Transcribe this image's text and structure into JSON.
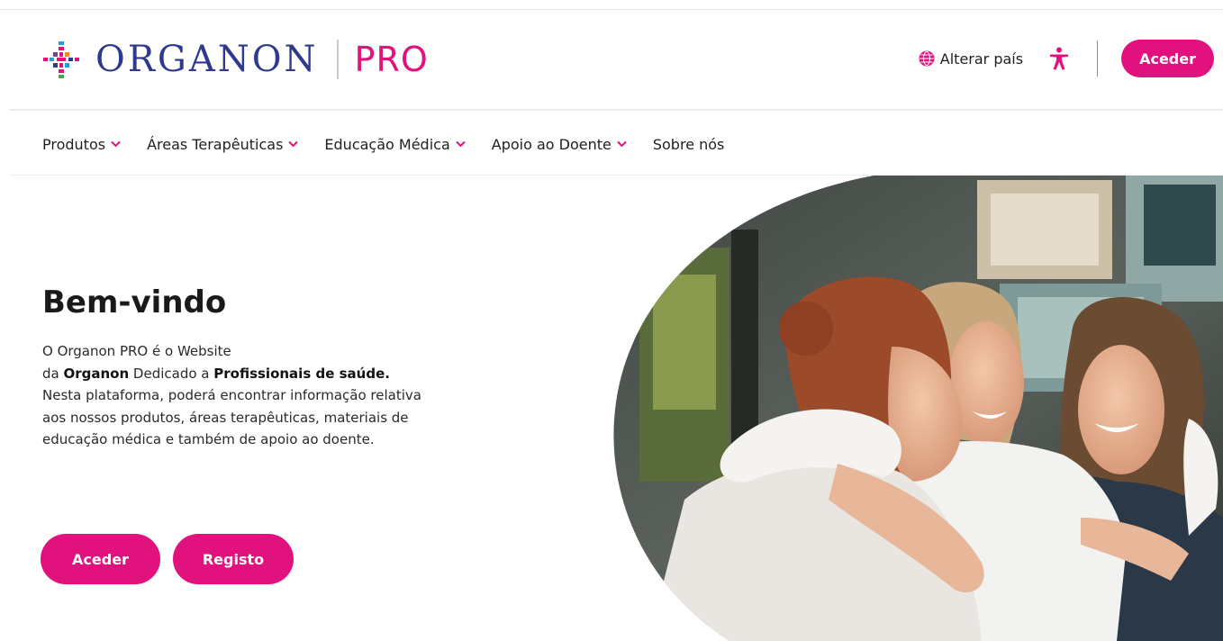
{
  "header": {
    "logo_word": "ORGANON",
    "logo_suffix": "PRO",
    "change_country": "Alterar país",
    "login_button": "Aceder"
  },
  "nav": {
    "items": [
      {
        "label": "Produtos",
        "dropdown": true
      },
      {
        "label": "Áreas Terapêuticas",
        "dropdown": true
      },
      {
        "label": "Educação Médica",
        "dropdown": true
      },
      {
        "label": "Apoio ao Doente",
        "dropdown": true
      },
      {
        "label": "Sobre nós",
        "dropdown": false
      }
    ]
  },
  "hero": {
    "title": "Bem-vindo",
    "text": {
      "p1": "O Organon PRO é o Website",
      "p2": "da ",
      "b1": "Organon",
      "p3": " Dedicado a ",
      "b2": "Profissionais de saúde.",
      "p4": " Nesta plataforma, poderá encontrar informação relativa aos nossos produtos, áreas terapêuticas, materiais de educação médica e também de apoio ao doente."
    },
    "buttons": {
      "login": "Aceder",
      "register": "Registo"
    }
  },
  "colors": {
    "brand_pink": "#e1117e",
    "brand_navy": "#2f3a8f"
  },
  "icons": [
    "organon-logo-icon",
    "globe-icon",
    "accessibility-icon",
    "chevron-down-icon"
  ]
}
